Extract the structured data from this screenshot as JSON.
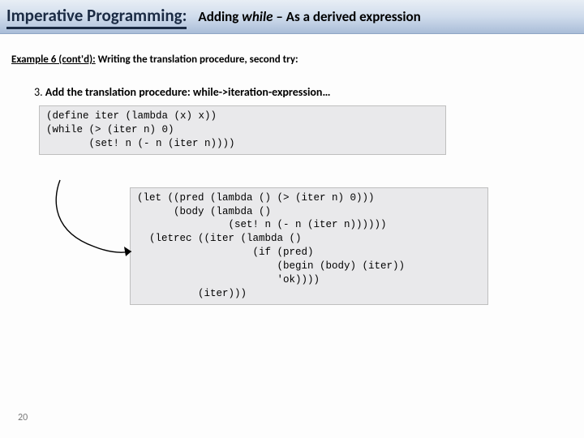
{
  "header": {
    "left": "Imperative Programming:",
    "right_prefix": "Adding ",
    "right_italic": "while",
    "right_suffix": " – As a derived expression"
  },
  "subtitle": {
    "label": "Example 6 (cont'd):",
    "rest": " Writing the translation procedure, second try:"
  },
  "step": {
    "num": "3.",
    "text": " Add the translation procedure: while->iteration-expression…"
  },
  "code1": "(define iter (lambda (x) x))\n(while (> (iter n) 0)\n       (set! n (- n (iter n))))",
  "code2": "(let ((pred (lambda () (> (iter n) 0)))\n      (body (lambda ()\n               (set! n (- n (iter n))))))\n  (letrec ((iter (lambda ()\n                   (if (pred)\n                       (begin (body) (iter))\n                       'ok))))\n          (iter)))",
  "page_number": "20"
}
